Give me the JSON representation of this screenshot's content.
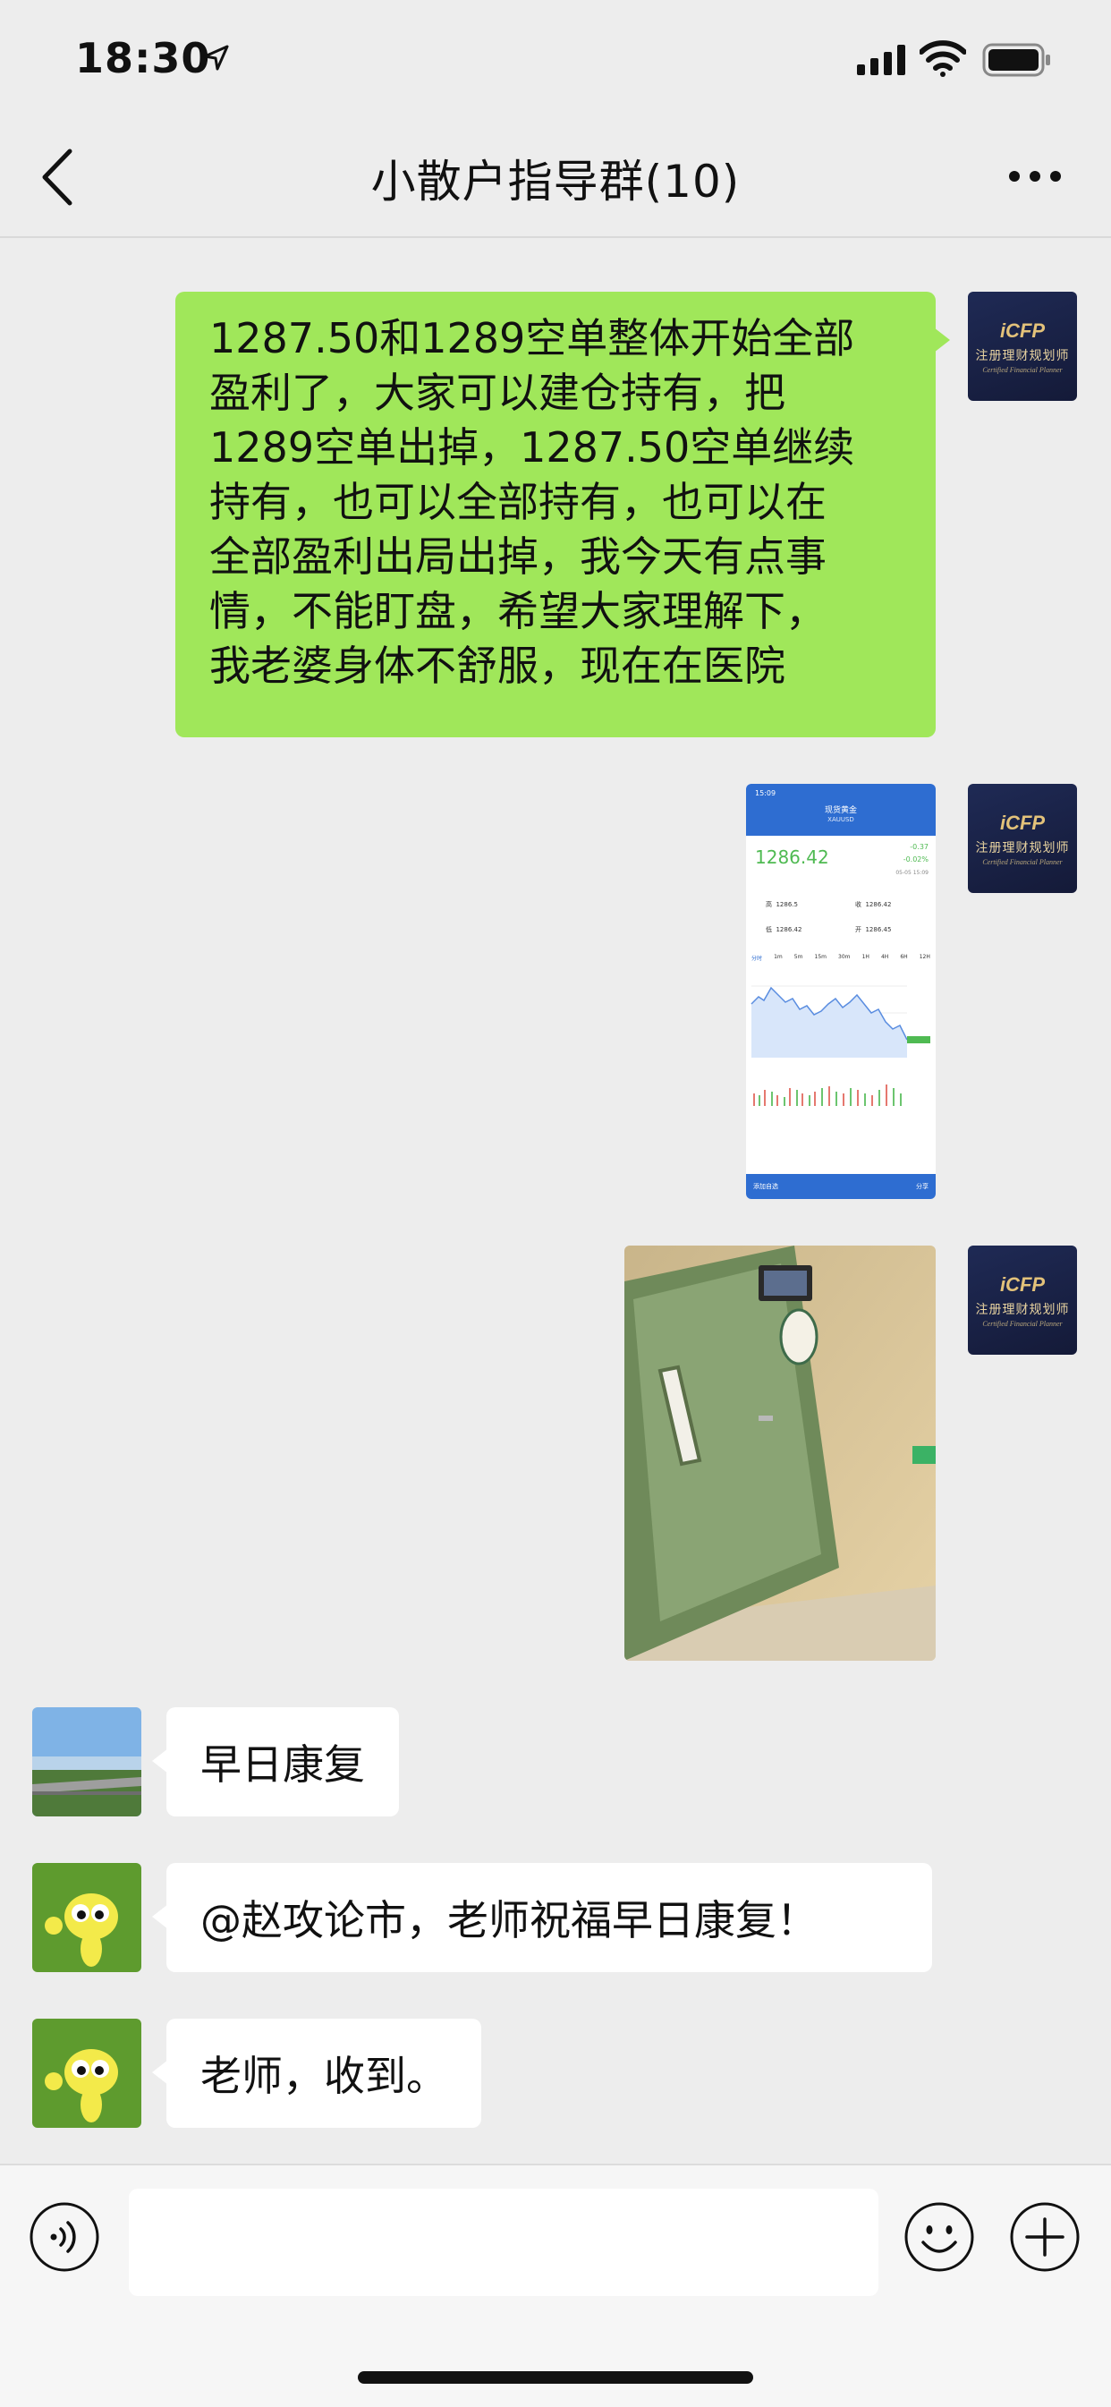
{
  "status_bar": {
    "time": "18:30"
  },
  "nav": {
    "title": "小散户指导群(10)",
    "back_icon": "chevron-left-icon",
    "more_icon": "more-dots-icon"
  },
  "messages": [
    {
      "sender": "self",
      "type": "text",
      "avatar": "cfp-avatar",
      "lines": [
        "1287.50和1289空单整体开始全部",
        "盈利了，大家可以建仓持有，把",
        "1289空单出掉，1287.50空单继续",
        "持有，也可以全部持有，也可以在",
        "全部盈利出局出掉，我今天有点事",
        "情，不能盯盘，希望大家理解下，",
        "我老婆身体不舒服，现在在医院"
      ]
    },
    {
      "sender": "self",
      "type": "image",
      "avatar": "cfp-avatar",
      "image": "stock-app-screenshot",
      "content": {
        "time": "15:09",
        "title": "现货黄金",
        "code": "XAUUSD",
        "price": "1286.42",
        "change": "-0.37",
        "change_pct": "-0.02%",
        "date": "05-05 15:09",
        "stats": [
          {
            "label": "高",
            "value": "1286.5"
          },
          {
            "label": "收",
            "value": "1286.42"
          },
          {
            "label": "低",
            "value": "1286.42"
          },
          {
            "label": "开",
            "value": "1286.45"
          }
        ],
        "tabs": [
          "分时",
          "1m",
          "5m",
          "15m",
          "30m",
          "1H",
          "4H",
          "6H",
          "12H"
        ],
        "bottom_left": "添加自选",
        "bottom_right": "分享"
      }
    },
    {
      "sender": "self",
      "type": "image",
      "avatar": "cfp-avatar",
      "image": "hospital-door-photo"
    },
    {
      "sender": "other",
      "type": "text",
      "avatar": "landscape-avatar",
      "text": "早日康复"
    },
    {
      "sender": "other",
      "type": "text",
      "avatar": "cartoon-bee-avatar",
      "text": "@赵攻论市，老师祝福早日康复！"
    },
    {
      "sender": "other",
      "type": "text",
      "avatar": "cartoon-bee-avatar",
      "text": "老师，收到。"
    }
  ],
  "cfp_avatar": {
    "logo": "iCFP",
    "cn": "注册理财规划师",
    "en": "Certified Financial Planner"
  },
  "input_bar": {
    "voice_icon": "voice-icon",
    "emoji_icon": "emoji-icon",
    "plus_icon": "plus-icon",
    "placeholder": ""
  },
  "colors": {
    "background": "#ededed",
    "self_bubble": "#a0e75a",
    "other_bubble": "#ffffff",
    "stock_green": "#4fba52",
    "stock_blue": "#2e6dd1"
  }
}
